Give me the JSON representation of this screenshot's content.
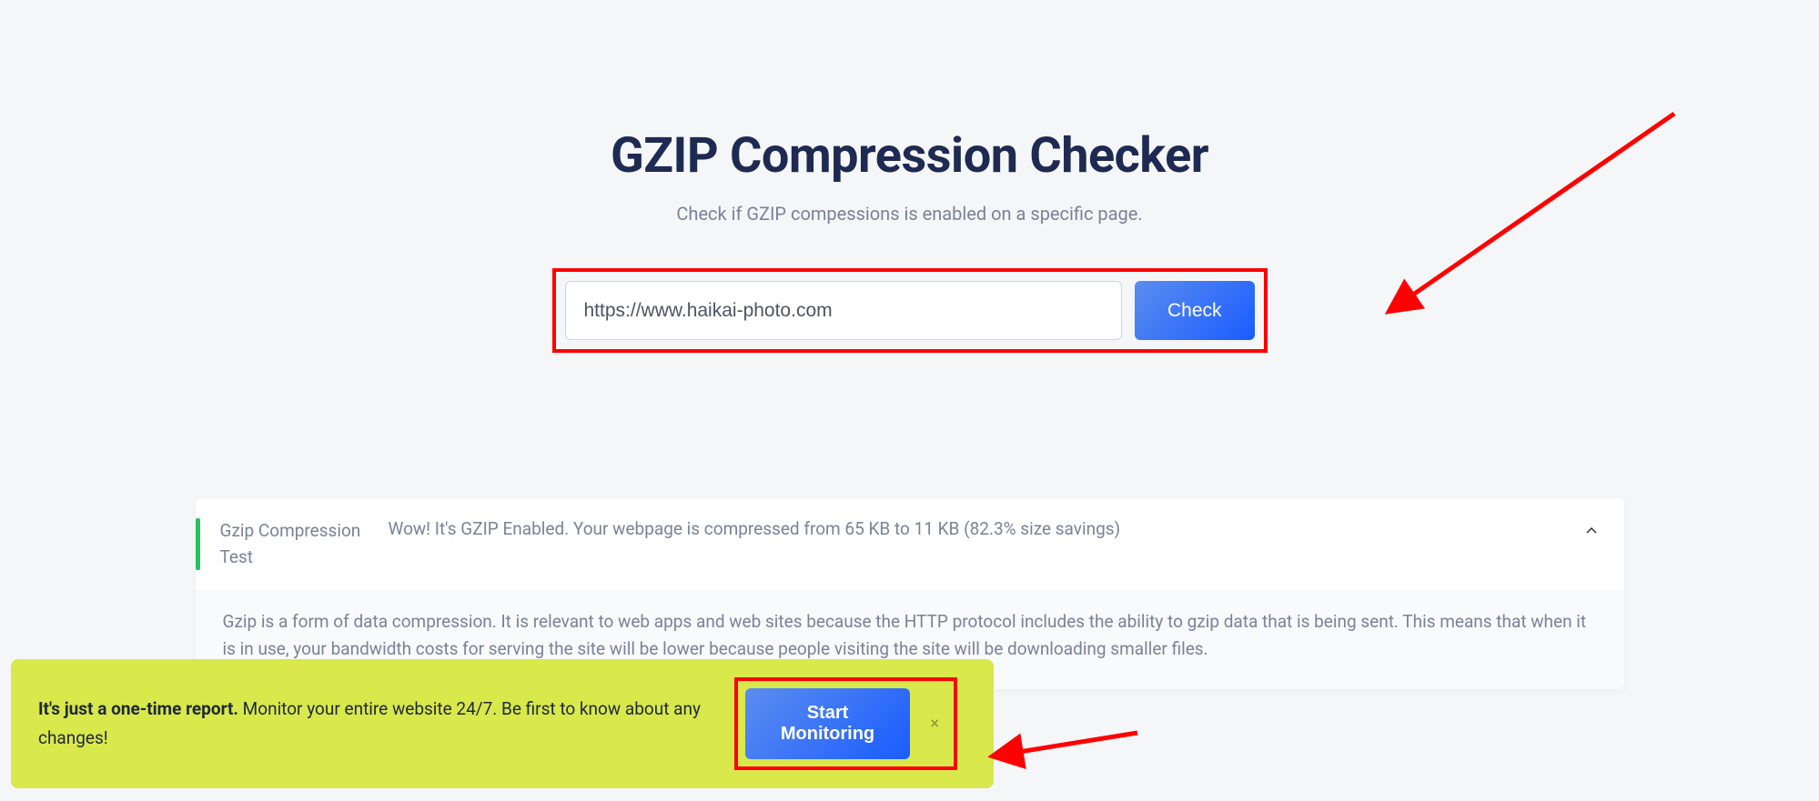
{
  "header": {
    "title": "GZIP Compression Checker",
    "subtitle": "Check if GZIP compessions is enabled on a specific page."
  },
  "form": {
    "url_value": "https://www.haikai-photo.com",
    "check_label": "Check"
  },
  "result": {
    "label": "Gzip Compression Test",
    "message": "Wow! It's GZIP Enabled. Your webpage is compressed from 65 KB to 11 KB (82.3% size savings)",
    "description": "Gzip is a form of data compression. It is relevant to web apps and web sites because the HTTP protocol includes the ability to gzip data that is being sent. This means that when it is in use, your bandwidth costs for serving the site will be lower because people visiting the site will be downloading smaller files."
  },
  "banner": {
    "bold": "It's just a one-time report.",
    "text": " Monitor your entire website 24/7. Be first to know about any changes!",
    "button": "Start Monitoring",
    "close": "×"
  },
  "colors": {
    "accent": "#1a5cff",
    "success": "#22c55e",
    "annotation": "#ff0000",
    "banner_bg": "#d9e84a",
    "heading": "#1e2a52",
    "muted": "#7a8299"
  }
}
